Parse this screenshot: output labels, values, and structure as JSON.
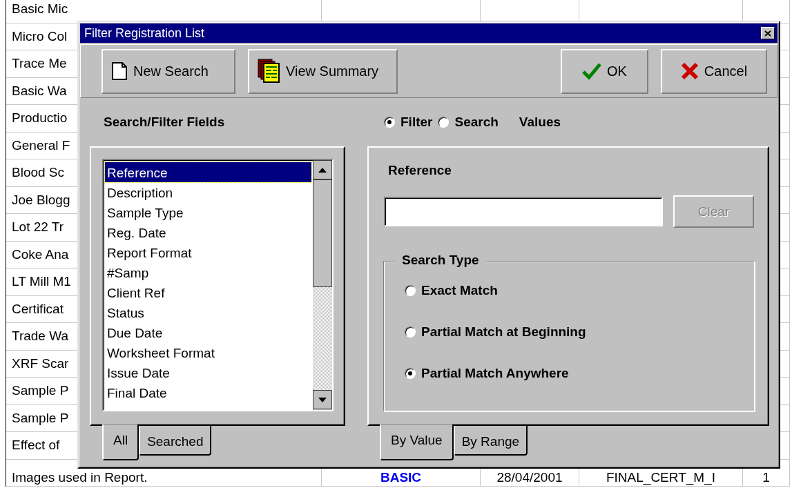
{
  "background_table": {
    "rows": [
      {
        "cells": [
          {
            "text": "Basic Mic"
          }
        ]
      },
      {
        "cells": [
          {
            "text": "Micro Col"
          }
        ]
      },
      {
        "cells": [
          {
            "text": "Trace Me"
          }
        ]
      },
      {
        "cells": [
          {
            "text": "Basic Wa"
          }
        ]
      },
      {
        "cells": [
          {
            "text": "Productio"
          }
        ]
      },
      {
        "cells": [
          {
            "text": "General F"
          }
        ]
      },
      {
        "cells": [
          {
            "text": "Blood Sc"
          }
        ]
      },
      {
        "cells": [
          {
            "text": "Joe Blogg"
          }
        ]
      },
      {
        "cells": [
          {
            "text": "Lot 22 Tr"
          }
        ]
      },
      {
        "cells": [
          {
            "text": "Coke Ana"
          }
        ]
      },
      {
        "cells": [
          {
            "text": "LT Mill M1"
          }
        ]
      },
      {
        "cells": [
          {
            "text": "Certificat"
          }
        ]
      },
      {
        "cells": [
          {
            "text": "Trade Wa"
          }
        ]
      },
      {
        "cells": [
          {
            "text": "XRF Scar"
          }
        ]
      },
      {
        "cells": [
          {
            "text": "Sample P"
          }
        ]
      },
      {
        "cells": [
          {
            "text": "Sample P"
          }
        ]
      },
      {
        "cells": [
          {
            "text": "Effect of"
          }
        ]
      },
      {
        "cells": [
          {
            "text": "Images used in Report."
          },
          {
            "text": "BASIC",
            "kind": "code"
          },
          {
            "text": "28/04/2001"
          },
          {
            "text": "FINAL_CERT_M_I"
          },
          {
            "text": "1"
          }
        ]
      }
    ]
  },
  "dialog": {
    "title": "Filter Registration List",
    "toolbar": {
      "left": [
        {
          "label": "New Search",
          "kind": "page"
        },
        {
          "label": "View Summary",
          "kind": "summary"
        }
      ],
      "right": [
        {
          "label": "OK",
          "kind": "check"
        },
        {
          "label": "Cancel",
          "kind": "cross"
        }
      ]
    },
    "fields_panel": {
      "heading": "Search/Filter Fields",
      "items": [
        {
          "label": "Reference",
          "selected": true
        },
        {
          "label": "Description",
          "selected": false
        },
        {
          "label": "Sample Type",
          "selected": false
        },
        {
          "label": "Reg. Date",
          "selected": false
        },
        {
          "label": "Report Format",
          "selected": false
        },
        {
          "label": "#Samp",
          "selected": false
        },
        {
          "label": "Client Ref",
          "selected": false
        },
        {
          "label": "Status",
          "selected": false
        },
        {
          "label": "Due Date",
          "selected": false
        },
        {
          "label": "Worksheet Format",
          "selected": false
        },
        {
          "label": "Issue Date",
          "selected": false
        },
        {
          "label": "Final Date",
          "selected": false
        }
      ],
      "tabs": [
        {
          "label": "All",
          "selected": true
        },
        {
          "label": "Searched",
          "selected": false
        }
      ]
    },
    "mode": {
      "options": [
        {
          "label": "Filter",
          "selected": true
        },
        {
          "label": "Search",
          "selected": false
        }
      ],
      "suffix": "Values"
    },
    "value_panel": {
      "field_label": "Reference",
      "clear_button": {
        "label": "Clear",
        "disabled": true
      },
      "search_type": {
        "legend": "Search Type",
        "options": [
          {
            "label": "Exact Match",
            "selected": false
          },
          {
            "label": "Partial Match at Beginning",
            "selected": false
          },
          {
            "label": "Partial Match Anywhere",
            "selected": true
          }
        ]
      },
      "tabs": [
        {
          "label": "By Value",
          "selected": true
        },
        {
          "label": "By Range",
          "selected": false
        }
      ]
    }
  }
}
